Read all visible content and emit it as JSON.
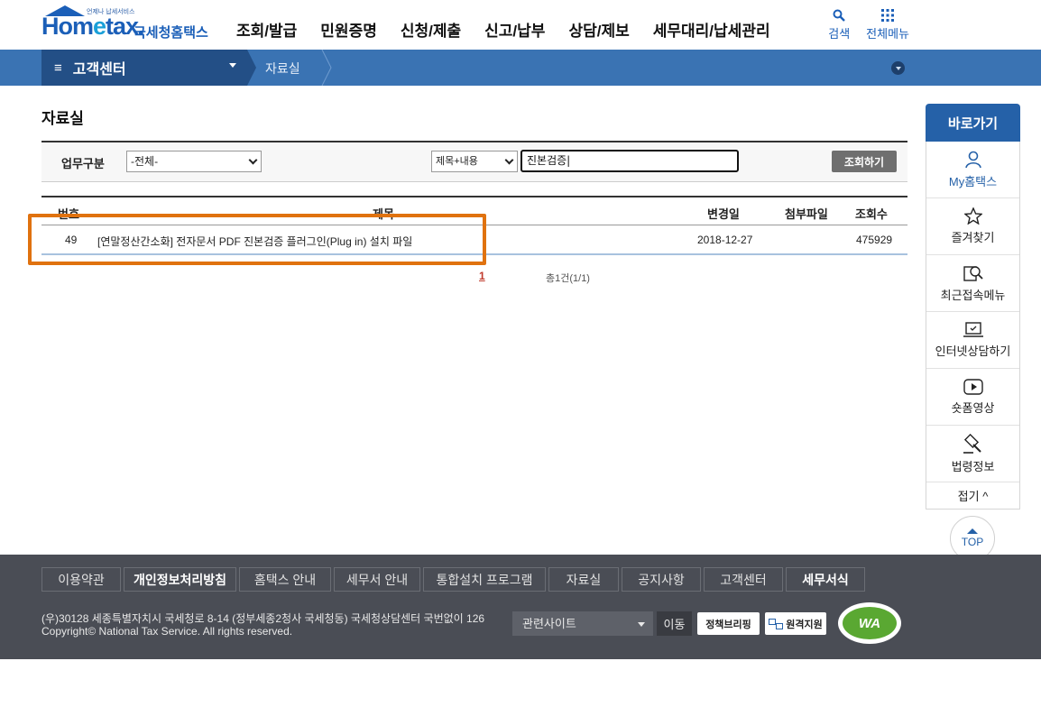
{
  "header": {
    "logo_small": "언제나 납세서비스",
    "logo_ho": "Hom",
    "logo_e": "e",
    "logo_tax": "tax.",
    "logo_kr": "국세청홈택스",
    "nav": [
      "조회/발급",
      "민원증명",
      "신청/제출",
      "신고/납부",
      "상담/제보",
      "세무대리/납세관리"
    ],
    "search_label": "검색",
    "all_menu_label": "전체메뉴"
  },
  "location": {
    "home": "고객센터",
    "current": "자료실"
  },
  "page": {
    "title": "자료실"
  },
  "search": {
    "category_label": "업무구분",
    "category_value": "-전체-",
    "field_value": "제목+내용",
    "query": "진본검증|",
    "submit_label": "조회하기"
  },
  "table": {
    "headers": {
      "no": "번호",
      "title": "제목",
      "date": "변경일",
      "attach": "첨부파일",
      "views": "조회수"
    },
    "rows": [
      {
        "no": "49",
        "title": "[연말정산간소화] 전자문서 PDF 진본검증 플러그인(Plug in) 설치 파일",
        "date": "2018-12-27",
        "attach": "",
        "views": "475929"
      }
    ]
  },
  "pagination": {
    "current": "1",
    "total": "총1건(1/1)"
  },
  "quick_menu": {
    "title": "바로가기",
    "items": [
      "My홈택스",
      "즐겨찾기",
      "최근접속메뉴",
      "인터넷상담하기",
      "숏폼영상",
      "법령정보"
    ],
    "fold": "접기 ^",
    "top": "TOP"
  },
  "footer": {
    "links": [
      "이용약관",
      "개인정보처리방침",
      "홈택스 안내",
      "세무서 안내",
      "통합설치 프로그램",
      "자료실",
      "공지사항",
      "고객센터",
      "세무서식"
    ],
    "address": "(우)30128 세종특별자치시 국세청로 8-14 (정부세종2청사 국세청동) 국세청상담센터 국번없이 126",
    "copyright": "Copyright© National Tax Service. All rights reserved.",
    "related_site": "관련사이트",
    "move": "이동",
    "policy_badge": "정책브리핑",
    "remote_badge": "원격지원",
    "wa_mark": "WA"
  },
  "colors": {
    "brand_blue": "#2561a8",
    "highlight_orange": "#e0720f",
    "footer_bg": "#4a4d55"
  }
}
